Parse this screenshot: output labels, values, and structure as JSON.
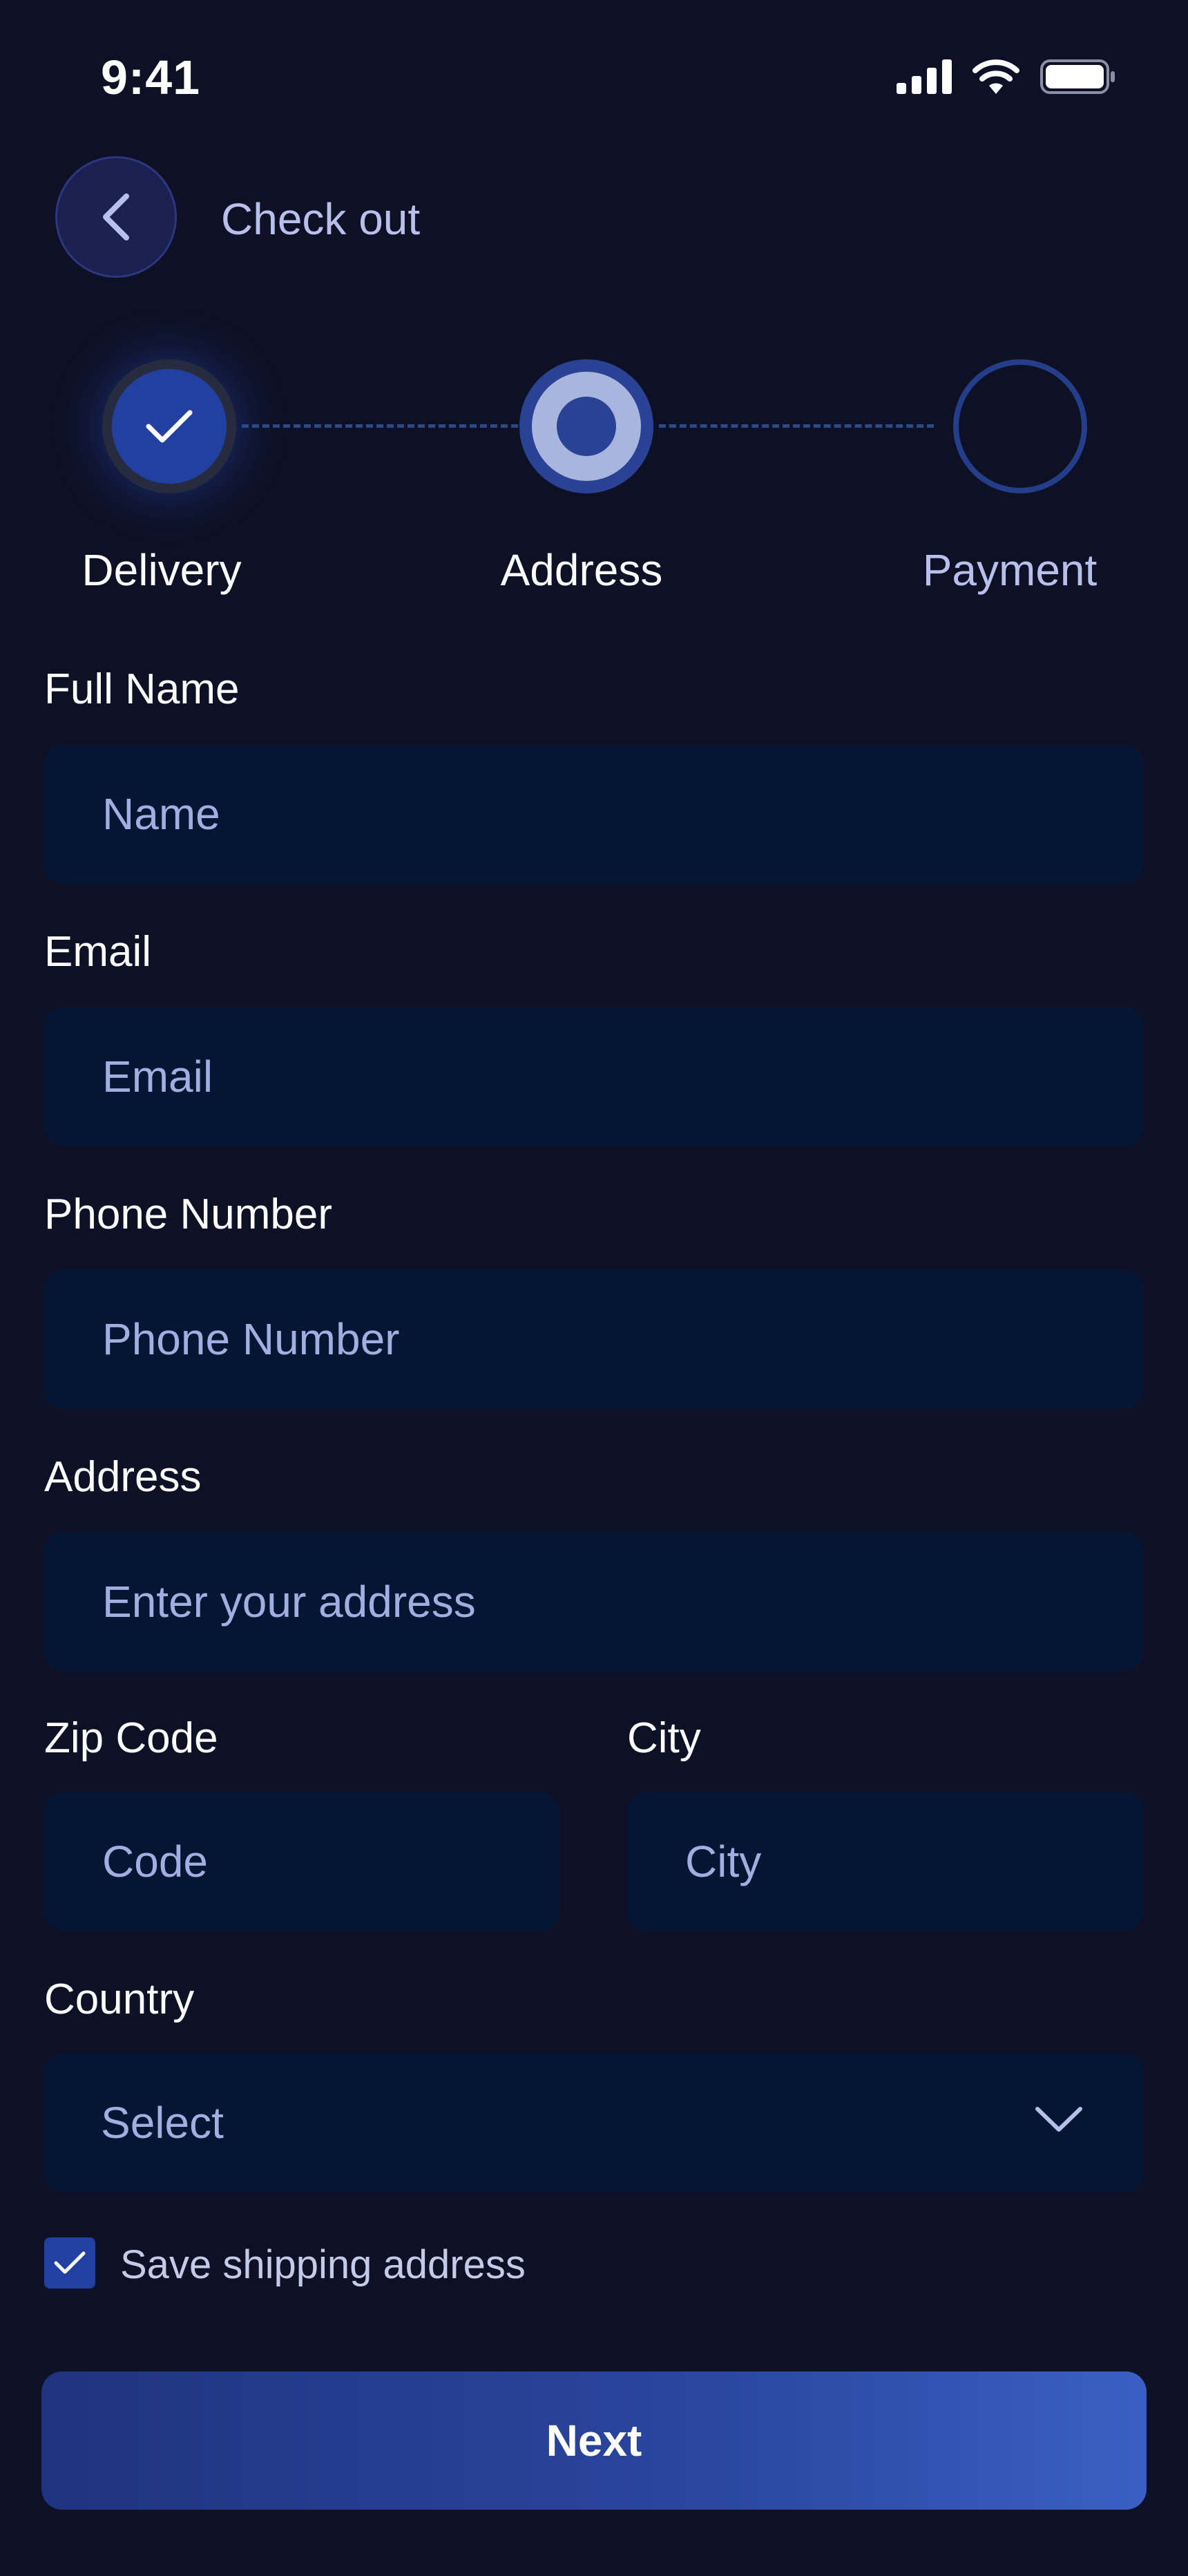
{
  "status_bar": {
    "time": "9:41"
  },
  "header": {
    "title": "Check out"
  },
  "stepper": {
    "steps": [
      {
        "label": "Delivery",
        "state": "completed"
      },
      {
        "label": "Address",
        "state": "active"
      },
      {
        "label": "Payment",
        "state": "upcoming"
      }
    ]
  },
  "form": {
    "full_name": {
      "label": "Full Name",
      "placeholder": "Name"
    },
    "email": {
      "label": "Email",
      "placeholder": "Email"
    },
    "phone": {
      "label": "Phone Number",
      "placeholder": "Phone Number"
    },
    "address": {
      "label": "Address",
      "placeholder": "Enter your address"
    },
    "zip": {
      "label": "Zip Code",
      "placeholder": "Code"
    },
    "city": {
      "label": "City",
      "placeholder": "City"
    },
    "country": {
      "label": "Country",
      "selected": "Select"
    },
    "save_address": {
      "label": "Save shipping address",
      "checked": true
    }
  },
  "actions": {
    "next_label": "Next"
  },
  "colors": {
    "background": "#0e1126",
    "input_bg": "#051634",
    "accent": "#2240a0",
    "placeholder": "#9fb0e0"
  }
}
